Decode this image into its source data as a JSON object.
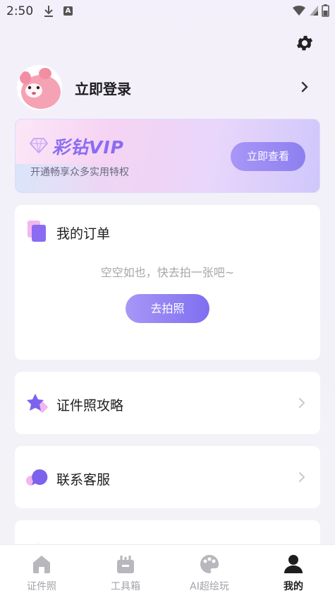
{
  "status": {
    "time": "2:50"
  },
  "profile": {
    "login_label": "立即登录"
  },
  "vip": {
    "title": "彩钻VIP",
    "subtitle": "开通畅享众多实用特权",
    "button_label": "立即查看"
  },
  "orders": {
    "title": "我的订单",
    "empty_text": "空空如也，快去拍一张吧~",
    "button_label": "去拍照"
  },
  "menu": [
    {
      "label": "证件照攻略",
      "icon": "star-icon"
    },
    {
      "label": "联系客服",
      "icon": "chat-bubble-icon"
    }
  ],
  "tabs": [
    {
      "label": "证件照",
      "icon": "home-icon",
      "active": false
    },
    {
      "label": "工具箱",
      "icon": "toolbox-icon",
      "active": false
    },
    {
      "label": "AI超绘玩",
      "icon": "palette-icon",
      "active": false
    },
    {
      "label": "我的",
      "icon": "user-icon",
      "active": true
    }
  ],
  "colors": {
    "accent": "#8a6bf2",
    "button_gradient_start": "#a797f6",
    "button_gradient_end": "#7f6ff0"
  }
}
